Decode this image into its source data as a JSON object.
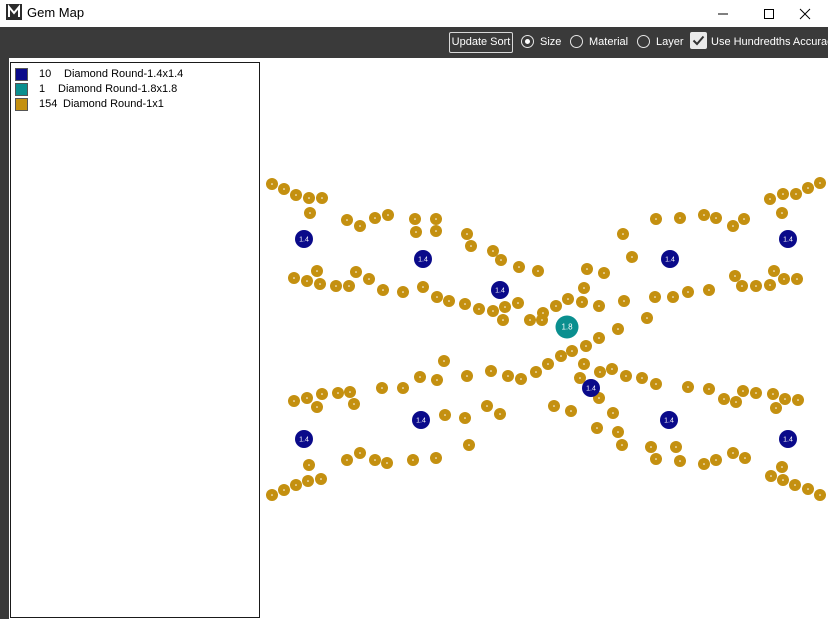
{
  "window": {
    "title": "Gem Map",
    "app_icon": "m-logo-icon",
    "buttons": [
      "minimize-icon",
      "maximize-icon",
      "close-icon"
    ]
  },
  "toolbar": {
    "update_sort_label": "Update Sort",
    "sort_options": [
      {
        "label": "Size",
        "selected": true
      },
      {
        "label": "Material",
        "selected": false
      },
      {
        "label": "Layer",
        "selected": false
      }
    ],
    "hundredths": {
      "label": "Use Hundredths Accuracy",
      "checked": true
    }
  },
  "legend": [
    {
      "count": "10",
      "desc": "Diamond Round-1.4x1.4",
      "color": "#0a0a8a"
    },
    {
      "count": "1",
      "desc": "Diamond Round-1.8x1.8",
      "color": "#0a8f8f"
    },
    {
      "count": "154",
      "desc": "Diamond Round-1x1",
      "color": "#c49010"
    }
  ],
  "gems": {
    "small_color": "#c49010",
    "medium_color": "#0a0a8a",
    "large_color": "#0a8f8f",
    "medium_label": "1.4",
    "large_label": "1.8"
  }
}
